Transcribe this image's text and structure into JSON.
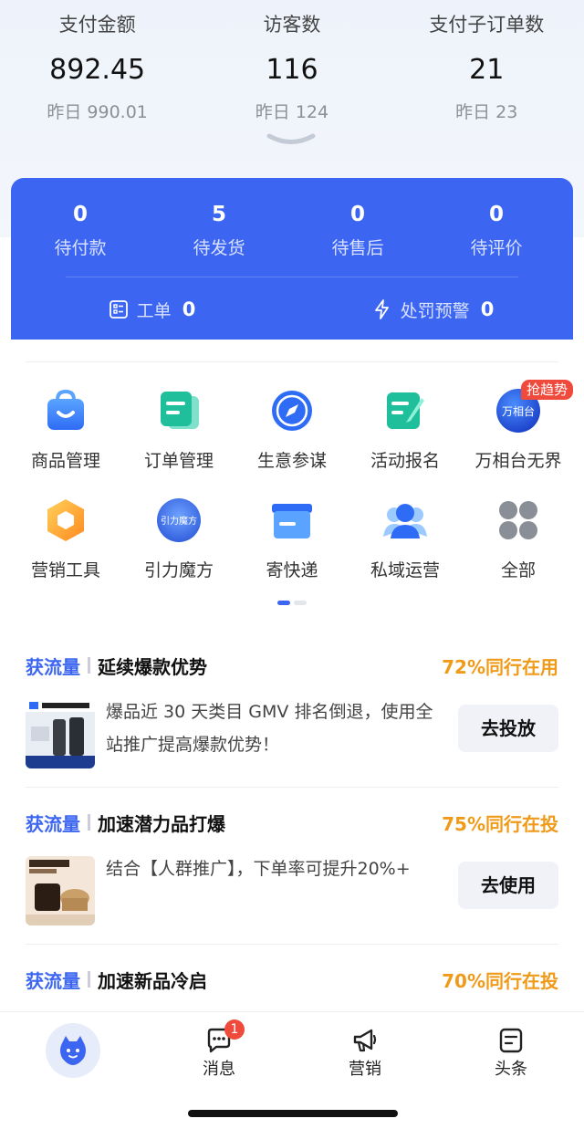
{
  "stats": [
    {
      "label": "支付金额",
      "value": "892.45",
      "yesterday": "昨日 990.01"
    },
    {
      "label": "访客数",
      "value": "116",
      "yesterday": "昨日 124"
    },
    {
      "label": "支付子订单数",
      "value": "21",
      "yesterday": "昨日 23"
    }
  ],
  "orders": [
    {
      "count": "0",
      "label": "待付款"
    },
    {
      "count": "5",
      "label": "待发货"
    },
    {
      "count": "0",
      "label": "待售后"
    },
    {
      "count": "0",
      "label": "待评价"
    }
  ],
  "order_links": {
    "ticket": {
      "label": "工单",
      "count": "0",
      "icon": "ticket-icon"
    },
    "penalty": {
      "label": "处罚预警",
      "count": "0",
      "icon": "lightning-icon"
    }
  },
  "tools": [
    {
      "label": "商品管理",
      "icon": "shopping-bag-icon"
    },
    {
      "label": "订单管理",
      "icon": "order-doc-icon"
    },
    {
      "label": "生意参谋",
      "icon": "compass-icon"
    },
    {
      "label": "活动报名",
      "icon": "edit-doc-icon"
    },
    {
      "label": "万相台无界",
      "icon": "wanxiangtai-logo",
      "badge": "抢趋势",
      "logo_text": "万相台"
    },
    {
      "label": "营销工具",
      "icon": "hexagon-icon"
    },
    {
      "label": "引力魔方",
      "icon": "yinlimofang-logo",
      "logo_text": "引力魔方"
    },
    {
      "label": "寄快递",
      "icon": "package-icon"
    },
    {
      "label": "私域运营",
      "icon": "users-icon"
    },
    {
      "label": "全部",
      "icon": "grid-icon"
    }
  ],
  "pager": {
    "pages": 2,
    "current": 1
  },
  "recommendations": [
    {
      "tag": "获流量",
      "title": "延续爆款优势",
      "stat": "72%同行在用",
      "desc": "爆品近 30 天类目 GMV 排名倒退，使用全站推广提高爆款优势！",
      "button": "去投放"
    },
    {
      "tag": "获流量",
      "title": "加速潜力品打爆",
      "stat": "75%同行在投",
      "desc": "结合【人群推广】，下单率可提升20%+",
      "button": "去使用"
    },
    {
      "tag": "获流量",
      "title": "加速新品冷启",
      "stat": "70%同行在投"
    }
  ],
  "tabbar": {
    "home_icon": "mascot-icon",
    "messages": {
      "label": "消息",
      "badge": "1",
      "icon": "chat-icon"
    },
    "marketing": {
      "label": "营销",
      "icon": "megaphone-icon"
    },
    "headlines": {
      "label": "头条",
      "icon": "news-icon"
    }
  },
  "colors": {
    "accent": "#3c66f2",
    "orange": "#f09a1a",
    "badge_red": "#f04a3c"
  }
}
